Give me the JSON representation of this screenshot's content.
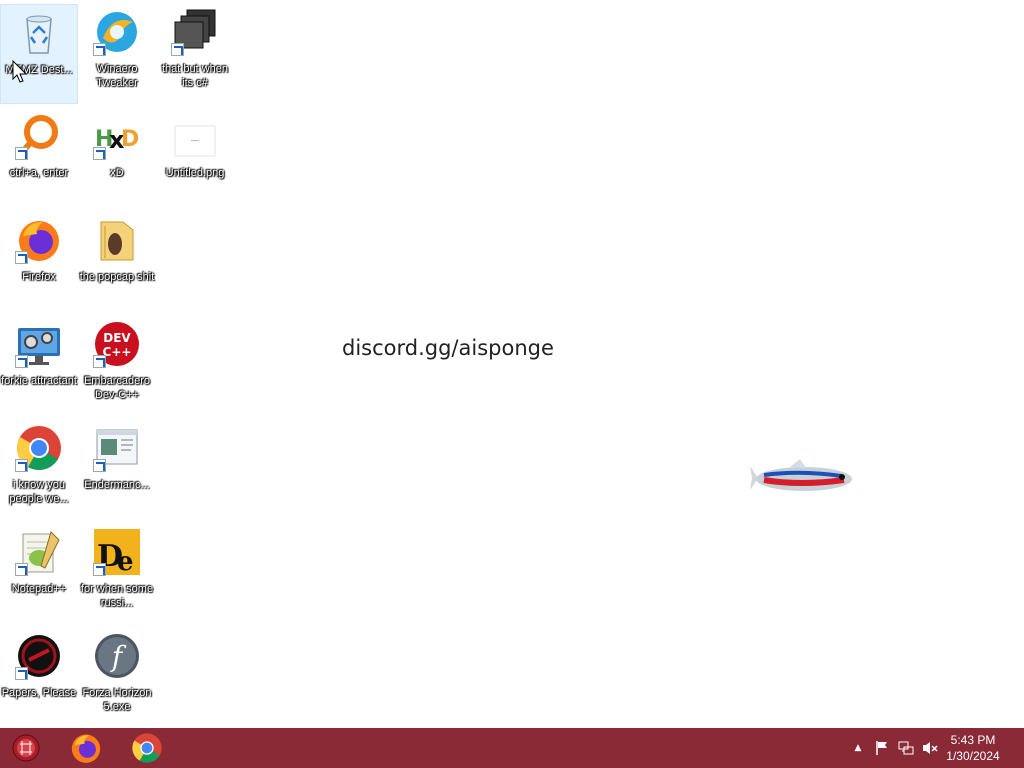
{
  "desktop": {
    "wallpaper_text": "discord.gg/aisponge",
    "icons": [
      {
        "label": "MEMZ Dest...",
        "icon": "recycle-bin-icon"
      },
      {
        "label": "Winaero Tweaker",
        "icon": "winaero-tweaker-icon"
      },
      {
        "label": "that but when its c#",
        "icon": "stacked-windows-icon"
      },
      {
        "label": "ctrl+a, enter",
        "icon": "search-magnifier-icon"
      },
      {
        "label": "xD",
        "icon": "hxd-icon"
      },
      {
        "label": "Untitled.png",
        "icon": "image-file-icon"
      },
      {
        "label": "Firefox",
        "icon": "firefox-icon"
      },
      {
        "label": "the popcap shit",
        "icon": "folder-icon"
      },
      {
        "label": "forkie attractant",
        "icon": "settings-monitor-icon"
      },
      {
        "label": "Embarcadero Dev-C++",
        "icon": "devcpp-icon"
      },
      {
        "label": "i know you people we...",
        "icon": "chrome-icon"
      },
      {
        "label": "Endermanc...",
        "icon": "window-app-icon"
      },
      {
        "label": "Notepad++",
        "icon": "notepadpp-icon"
      },
      {
        "label": "for when some russi...",
        "icon": "de-app-icon"
      },
      {
        "label": "Papers, Please",
        "icon": "papers-please-icon"
      },
      {
        "label": "Forza Horizon 5.exe",
        "icon": "flash-icon"
      }
    ]
  },
  "taskbar": {
    "color": "#8b2a37",
    "pinned": [
      {
        "name": "start-button",
        "icon": "start-orb-icon"
      },
      {
        "name": "firefox-taskbar-button",
        "icon": "firefox-icon"
      },
      {
        "name": "chrome-taskbar-button",
        "icon": "chrome-icon"
      }
    ],
    "tray": {
      "show_hidden": "▲",
      "clock_time": "5:43 PM",
      "clock_date": "1/30/2024"
    }
  }
}
